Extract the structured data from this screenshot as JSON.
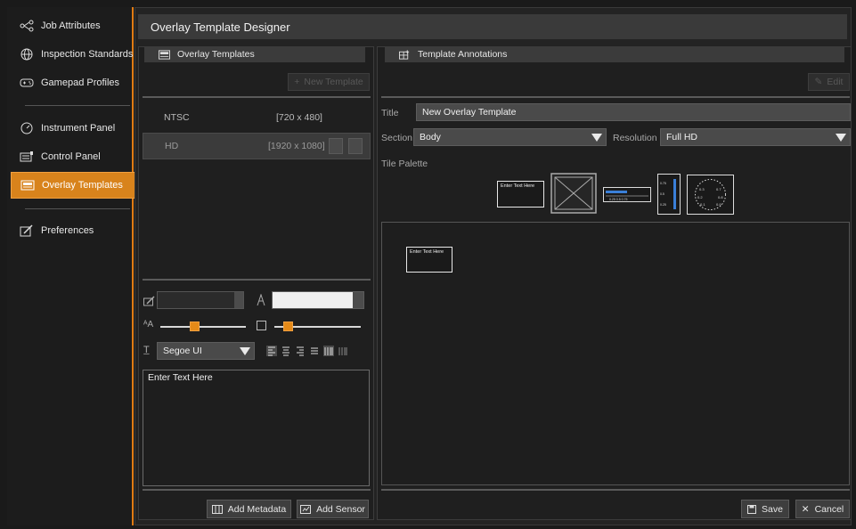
{
  "sidebar": {
    "items": [
      {
        "label": "Job Attributes",
        "icon": "share-nodes-icon"
      },
      {
        "label": "Inspection Standards",
        "icon": "globe-icon"
      },
      {
        "label": "Gamepad Profiles",
        "icon": "gamepad-icon"
      },
      {
        "label": "Instrument Panel",
        "icon": "gauge-icon"
      },
      {
        "label": "Control Panel",
        "icon": "control-panel-icon"
      },
      {
        "label": "Overlay Templates",
        "icon": "overlay-icon",
        "active": true
      },
      {
        "label": "Preferences",
        "icon": "preferences-icon"
      }
    ]
  },
  "header": {
    "title": "Overlay Template Designer"
  },
  "templates_pane": {
    "title": "Overlay Templates",
    "new_button": "New Template",
    "rows": [
      {
        "name": "NTSC",
        "resolution": "[720 x 480]"
      },
      {
        "name": "HD",
        "resolution": "[1920 x 1080]"
      }
    ],
    "font": "Segoe UI",
    "text_value": "Enter Text Here",
    "add_metadata": "Add Metadata",
    "add_sensor": "Add Sensor"
  },
  "annotations_pane": {
    "title": "Template Annotations",
    "edit_button": "Edit",
    "title_label": "Title",
    "title_value": "New Overlay Template",
    "section_label": "Section",
    "section_value": "Body",
    "resolution_label": "Resolution",
    "resolution_value": "Full HD",
    "tile_palette_label": "Tile Palette",
    "tile_text": "Enter Text Here",
    "placed_text": "Enter Text Here",
    "save_button": "Save",
    "cancel_button": "Cancel"
  },
  "colors": {
    "accent": "#e07b14",
    "panel": "#232323",
    "header": "#3a3a3a"
  }
}
